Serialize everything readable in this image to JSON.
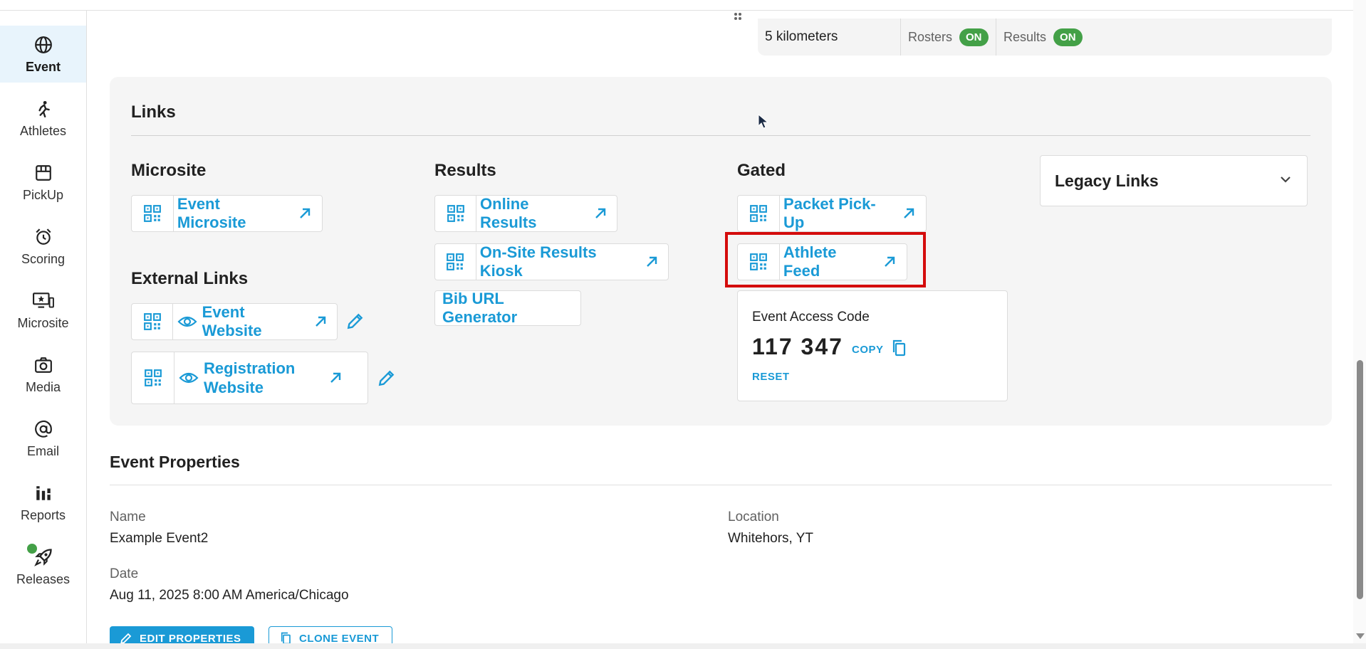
{
  "sidebar": {
    "items": [
      {
        "label": "Event",
        "icon": "globe-icon"
      },
      {
        "label": "Athletes",
        "icon": "runner-icon"
      },
      {
        "label": "PickUp",
        "icon": "storefront-icon"
      },
      {
        "label": "Scoring",
        "icon": "alarm-clock-icon"
      },
      {
        "label": "Microsite",
        "icon": "monitor-star-icon"
      },
      {
        "label": "Media",
        "icon": "camera-icon"
      },
      {
        "label": "Email",
        "icon": "at-sign-icon"
      },
      {
        "label": "Reports",
        "icon": "bar-chart-icon"
      },
      {
        "label": "Releases",
        "icon": "rocket-icon"
      }
    ]
  },
  "route": {
    "distance": "5 kilometers",
    "rosters_label": "Rosters",
    "rosters_state": "ON",
    "results_label": "Results",
    "results_state": "ON"
  },
  "links": {
    "title": "Links",
    "microsite": {
      "heading": "Microsite",
      "event_microsite": "Event Microsite"
    },
    "external": {
      "heading": "External Links",
      "event_website": "Event Website",
      "registration_website": "Registration Website"
    },
    "results": {
      "heading": "Results",
      "online_results": "Online Results",
      "kiosk": "On-Site Results Kiosk",
      "bib_generator": "Bib URL Generator"
    },
    "gated": {
      "heading": "Gated",
      "packet_pickup": "Packet Pick-Up",
      "athlete_feed": "Athlete Feed",
      "access_code_label": "Event Access Code",
      "access_code": "117 347",
      "copy_label": "COPY",
      "reset_label": "RESET"
    },
    "legacy": {
      "title": "Legacy Links"
    }
  },
  "properties": {
    "title": "Event Properties",
    "name_label": "Name",
    "name_value": "Example Event2",
    "location_label": "Location",
    "location_value": "Whitehors, YT",
    "date_label": "Date",
    "date_value": "Aug 11, 2025 8:00 AM America/Chicago",
    "edit_label": "EDIT PROPERTIES",
    "clone_label": "CLONE EVENT"
  },
  "colors": {
    "accent": "#1a9ad6",
    "on_pill": "#43a047",
    "highlight": "#d40c0c"
  }
}
